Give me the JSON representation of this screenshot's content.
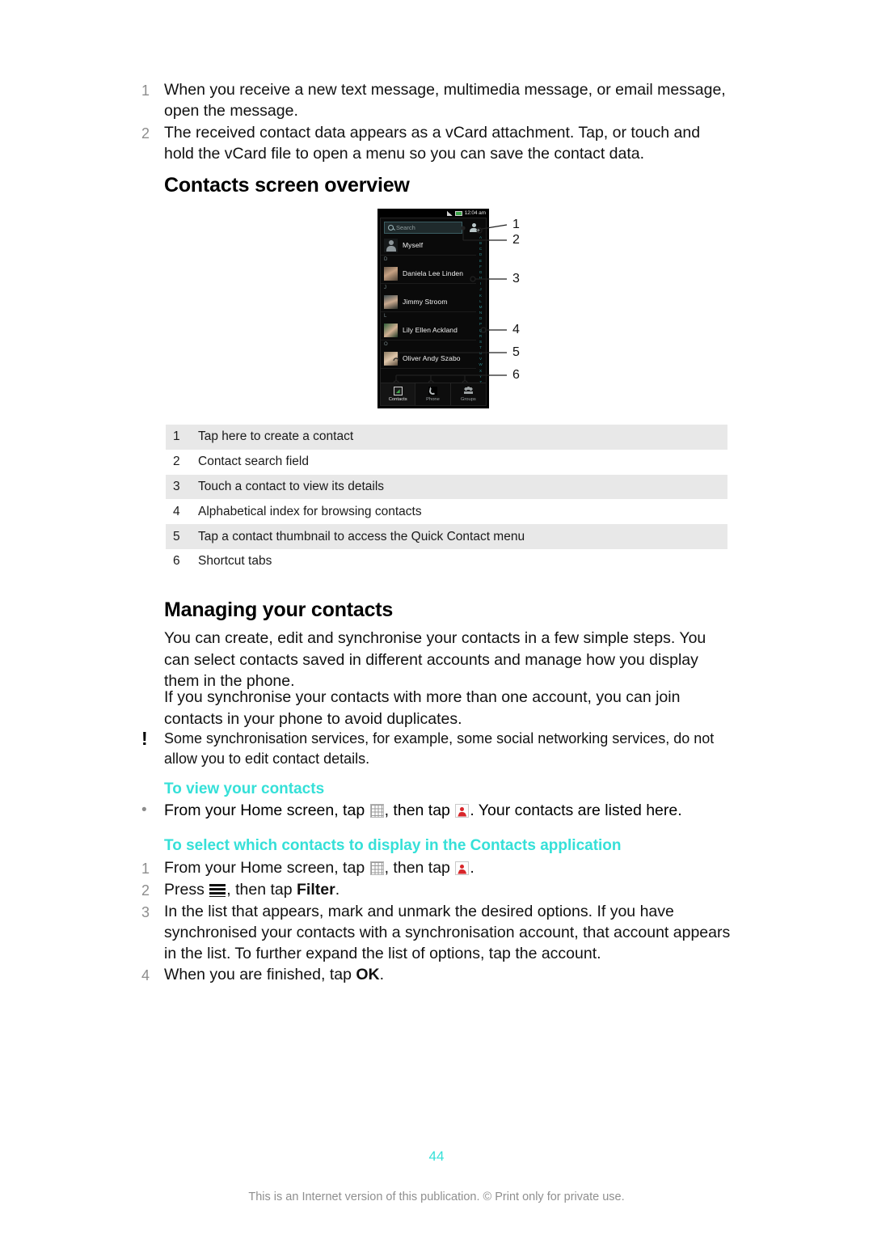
{
  "intro_steps": [
    {
      "num": "1",
      "text": "When you receive a new text message, multimedia message, or email message, open the message."
    },
    {
      "num": "2",
      "text": "The received contact data appears as a vCard attachment. Tap, or touch and hold the vCard file to open a menu so you can save the contact data."
    }
  ],
  "headings": {
    "contacts_screen_overview": "Contacts screen overview",
    "managing_your_contacts": "Managing your contacts",
    "to_view_your_contacts": "To view your contacts",
    "to_select_contacts": "To select which contacts to display in the Contacts application"
  },
  "phone": {
    "statusbar": {
      "time": "12:04 am",
      "signal_icon": "signal-bars-icon",
      "battery_icon": "battery-icon"
    },
    "search": {
      "placeholder": "Search",
      "icon": "search-icon"
    },
    "add_contact_icon": "add-contact-icon",
    "contacts": [
      {
        "group": "",
        "name": "Myself",
        "thumb": "generic-avatar"
      },
      {
        "group": "D",
        "name": "Daniela Lee Linden",
        "thumb": "photo-avatar"
      },
      {
        "group": "J",
        "name": "Jimmy Stroom",
        "thumb": "photo-avatar"
      },
      {
        "group": "L",
        "name": "Lily Ellen Ackland",
        "thumb": "photo-avatar"
      },
      {
        "group": "O",
        "name": "Oliver Andy Szabo",
        "thumb": "photo-avatar"
      }
    ],
    "alpha_index": [
      "A",
      "B",
      "C",
      "D",
      "E",
      "F",
      "G",
      "H",
      "I",
      "J",
      "K",
      "L",
      "M",
      "N",
      "O",
      "P",
      "Q",
      "R",
      "S",
      "T",
      "U",
      "V",
      "W",
      "X",
      "Y",
      "Z",
      "#"
    ],
    "tabs": [
      {
        "label": "Contacts",
        "icon": "contacts-tab-icon",
        "active": true
      },
      {
        "label": "Phone",
        "icon": "phone-tab-icon",
        "active": false
      },
      {
        "label": "Groups",
        "icon": "groups-tab-icon",
        "active": false
      }
    ]
  },
  "callout_numbers": [
    "1",
    "2",
    "3",
    "4",
    "5",
    "6"
  ],
  "callout_table": [
    {
      "num": "1",
      "text": "Tap here to create a contact"
    },
    {
      "num": "2",
      "text": "Contact search field"
    },
    {
      "num": "3",
      "text": "Touch a contact to view its details"
    },
    {
      "num": "4",
      "text": "Alphabetical index for browsing contacts"
    },
    {
      "num": "5",
      "text": "Tap a contact thumbnail to access the Quick Contact menu"
    },
    {
      "num": "6",
      "text": "Shortcut tabs"
    }
  ],
  "paragraphs": {
    "p1": "You can create, edit and synchronise your contacts in a few simple steps. You can select contacts saved in different accounts and manage how you display them in the phone.",
    "p2": "If you synchronise your contacts with more than one account, you can join contacts in your phone to avoid duplicates."
  },
  "note": {
    "icon": "exclamation-icon",
    "bang": "!",
    "text": "Some synchronisation services, for example, some social networking services, do not allow you to edit contact details."
  },
  "view_contacts_step": {
    "bullet": "•",
    "part1": "From your Home screen, tap ",
    "part2": ", then tap ",
    "part3": ". Your contacts are listed here."
  },
  "select_contacts_steps": {
    "s1": {
      "num": "1",
      "part1": "From your Home screen, tap ",
      "part2": ", then tap ",
      "part3": "."
    },
    "s2": {
      "num": "2",
      "part1": "Press ",
      "part2": ", then tap ",
      "bold": "Filter",
      "part3": "."
    },
    "s3": {
      "num": "3",
      "text": "In the list that appears, mark and unmark the desired options. If you have synchronised your contacts with a synchronisation account, that account appears in the list. To further expand the list of options, tap the account."
    },
    "s4": {
      "num": "4",
      "part1": "When you are finished, tap ",
      "bold": "OK",
      "part2": "."
    }
  },
  "footer": {
    "page_number": "44",
    "notice": "This is an Internet version of this publication. © Print only for private use."
  },
  "colors": {
    "accent_cyan": "#35e0d8",
    "table_shade": "#e8e8e8",
    "muted_gray": "#8d8d8d"
  }
}
